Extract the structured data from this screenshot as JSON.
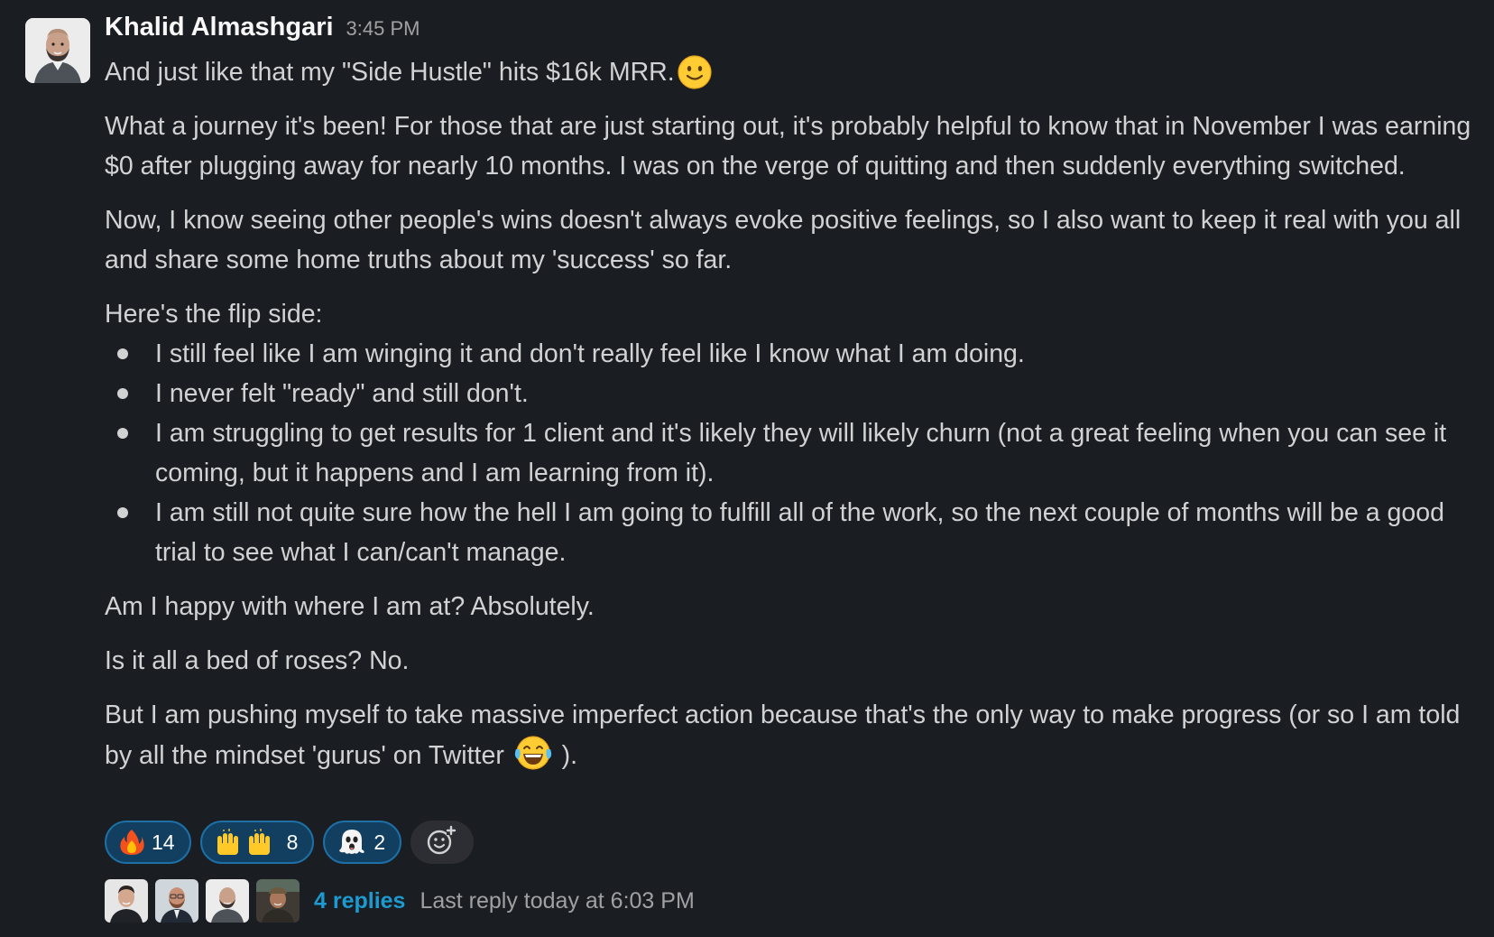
{
  "message": {
    "author": "Khalid Almashgari",
    "timestamp": "3:45 PM",
    "first_line": "And just like that my \"Side Hustle\" hits $16k MRR.",
    "first_line_emoji": "slightly-smiling-face",
    "paragraph_1": "What a journey it's been! For those that are just starting out, it's probably helpful to know that in November I was earning $0 after plugging away for nearly 10 months. I was on the verge of quitting and then suddenly everything switched.",
    "paragraph_2": "Now, I know seeing other people's wins doesn't always evoke positive feelings, so I also want to keep it real with you all and share some home truths about my 'success' so far.",
    "flip_intro": "Here's the flip side:",
    "bullets": [
      "I still feel like I am winging it and don't really feel like I know what I am doing.",
      "I never felt \"ready\" and still don't.",
      "I am struggling to get results for 1 client and it's likely they will likely churn (not a great feeling when you can see it coming, but it happens and I am learning from it).",
      "I am still not quite sure how the hell I am going to fulfill all of the work, so the next couple of months will be a good trial to see what I can/can't manage."
    ],
    "paragraph_happy": "Am I happy with where I am at? Absolutely.",
    "paragraph_roses": "Is it all a bed of roses? No.",
    "paragraph_last": "But I am pushing myself to take massive imperfect action because that's the only way to make progress (or so I am told by all the mindset 'gurus' on Twitter",
    "paragraph_last_emoji": "joy",
    "paragraph_last_end": ")."
  },
  "reactions": [
    {
      "emoji": "fire",
      "count": "14"
    },
    {
      "emoji": "raised-hands",
      "count": "8"
    },
    {
      "emoji": "ghost",
      "count": "2"
    }
  ],
  "add_reaction_icon": "add-reaction-icon",
  "thread": {
    "replies": "4 replies",
    "last_reply": "Last reply today at 6:03 PM"
  },
  "colors": {
    "background": "#1a1d21",
    "text": "#d1d2d3",
    "author": "#f8f8f8",
    "muted": "#a0a1a3",
    "link": "#1d9bd1",
    "reaction_bg": "#123f60",
    "reaction_border": "#1d6fa5"
  }
}
